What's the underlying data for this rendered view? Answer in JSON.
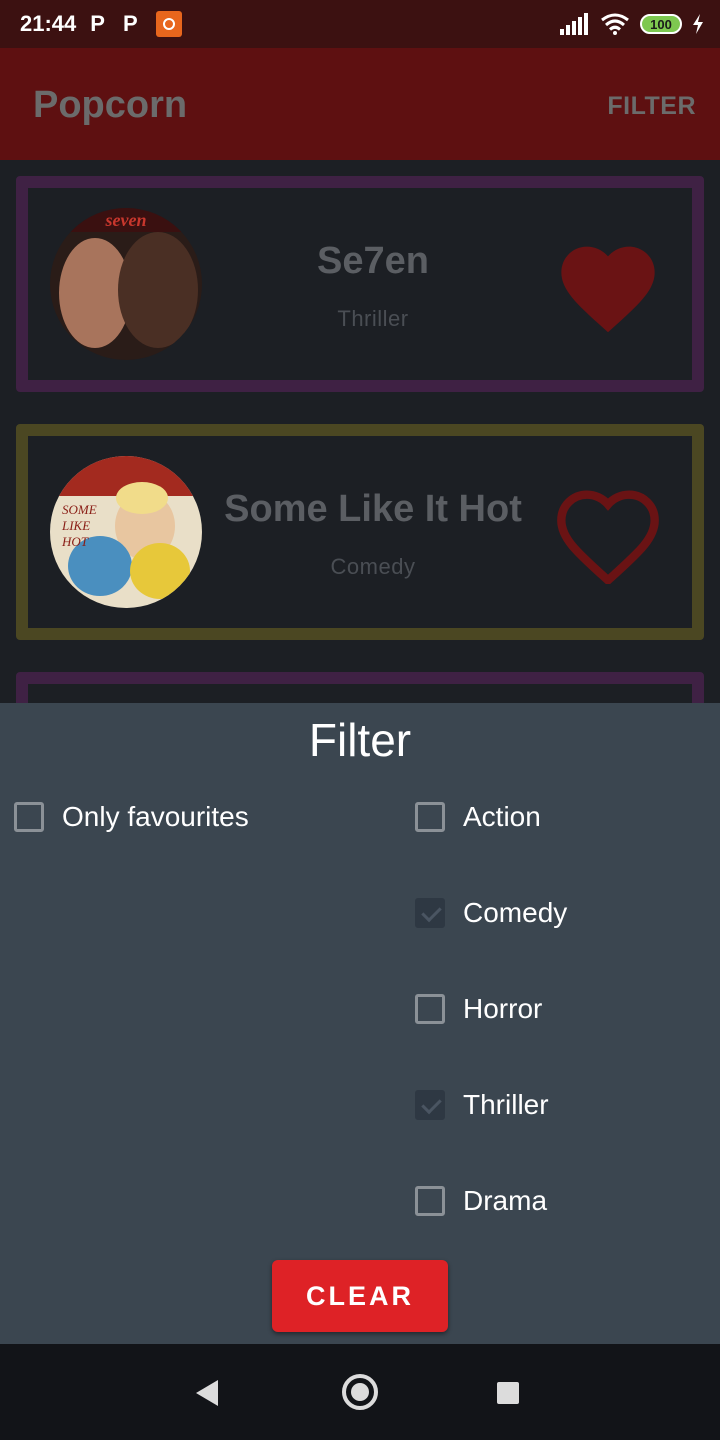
{
  "status_bar": {
    "time": "21:44",
    "notification_icons": [
      "P",
      "P"
    ],
    "battery": "100"
  },
  "app_bar": {
    "title": "Popcorn",
    "filter_label": "FILTER",
    "background": "#5e1011"
  },
  "movies": [
    {
      "title": "Se7en",
      "genre": "Thriller",
      "favourite": true,
      "border_color": "#3f2144"
    },
    {
      "title": "Some Like It Hot",
      "genre": "Comedy",
      "favourite": false,
      "border_color": "#4b4722"
    }
  ],
  "filter_sheet": {
    "title": "Filter",
    "only_favourites": {
      "label": "Only favourites",
      "checked": false
    },
    "genres": [
      {
        "label": "Action",
        "checked": false
      },
      {
        "label": "Comedy",
        "checked": true
      },
      {
        "label": "Horror",
        "checked": false
      },
      {
        "label": "Thriller",
        "checked": true
      },
      {
        "label": "Drama",
        "checked": false
      }
    ],
    "clear_label": "CLEAR",
    "clear_color": "#de2226"
  },
  "icons": {
    "favourite": "heart-filled-icon",
    "not_favourite": "heart-outline-icon",
    "nav_back": "back-triangle-icon",
    "nav_home": "home-circle-icon",
    "nav_recents": "recents-square-icon"
  }
}
